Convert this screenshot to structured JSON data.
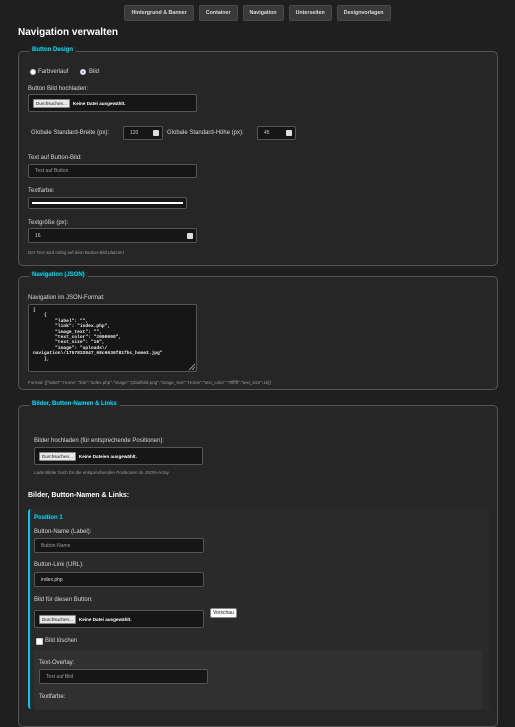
{
  "tabs": [
    "Hintergrund & Banner",
    "Container",
    "Navigation",
    "Unterseiten",
    "Designvorlagen"
  ],
  "page_title": "Navigation verwalten",
  "button_design": {
    "legend": "Button Design",
    "radio_gradient": "Farbverlauf",
    "radio_image": "Bild",
    "upload_label": "Button Bild hochladen:",
    "file_button": "Durchsuchen...",
    "file_none": "Keine Datei ausgewählt.",
    "width_label": "Globale Standard-Breite (px):",
    "width_value": "120",
    "height_label": "Globale Standard-Höhe (px):",
    "height_value": "45",
    "text_label": "Text auf Button-Bild:",
    "text_placeholder": "Text auf Button",
    "color_label": "Textfarbe:",
    "size_label": "Textgröße (px):",
    "size_value": "16",
    "size_hint": "Der Text wird mittig auf dem Button-Bild platziert"
  },
  "navigation_json": {
    "legend": "Navigation (JSON)",
    "label": "Navigation im JSON-Format:",
    "content": "[\n    {\n        \"label\": \"\",\n        \"link\": \"index.php\",\n        \"image_text\": \"\",\n        \"text_color\": \"#000000\",\n        \"text_size\": \"16\",\n        \"image\": \"uploads\\/\nnavigation\\/1757832047_68c6636f81fbc_home2.jpg\"\n    },",
    "format_hint": "Format: [{\"label\":\"Home\",\"link\":\"index.php\",\"image\":\"pfad/bild.png\",\"image_text\":\"Home\",\"text_color\":\"#ffffff\",\"text_size\":16}]"
  },
  "images_section": {
    "legend": "Bilder, Button-Namen & Links",
    "upload_label": "Bilder hochladen (für entsprechende Positionen):",
    "file_button": "Durchsuchen...",
    "file_none": "Keine Dateien ausgewählt.",
    "upload_hint": "Lade Bilder hoch für die entsprechenden Positionen im JSON-Array",
    "heading": "Bilder, Button-Namen & Links:",
    "position": {
      "title": "Position 1",
      "name_label": "Button-Name (Label):",
      "name_placeholder": "Button-Name",
      "link_label": "Button-Link (URL):",
      "link_value": "index.php",
      "image_label": "Bild für diesen Button:",
      "file_button": "Durchsuchen...",
      "file_none": "Keine Datei ausgewählt.",
      "preview_label": "Vorschau",
      "delete_label": "Bild löschen",
      "overlay_label": "Text-Overlay:",
      "overlay_placeholder": "Text auf Bild",
      "overlay_color_label": "Textfarbe:"
    }
  }
}
